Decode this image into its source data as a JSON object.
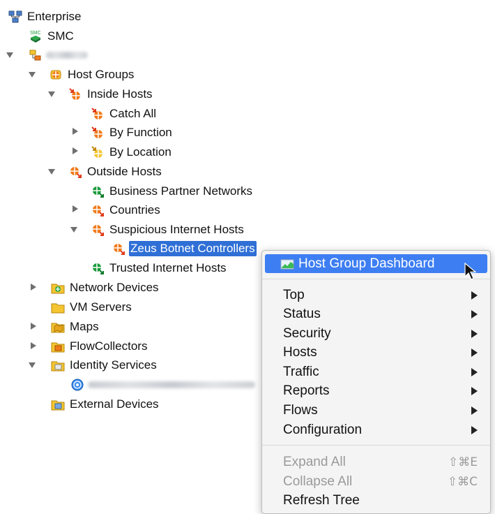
{
  "tree": {
    "enterprise": "Enterprise",
    "smc": "SMC",
    "host_groups": "Host Groups",
    "inside_hosts": "Inside Hosts",
    "catch_all": "Catch All",
    "by_function": "By Function",
    "by_location": "By Location",
    "outside_hosts": "Outside Hosts",
    "business_partner_networks": "Business Partner Networks",
    "countries": "Countries",
    "suspicious_internet_hosts": "Suspicious Internet Hosts",
    "zeus_botnet_controllers": "Zeus Botnet Controllers",
    "trusted_internet_hosts": "Trusted Internet Hosts",
    "network_devices": "Network Devices",
    "vm_servers": "VM Servers",
    "maps": "Maps",
    "flowcollectors": "FlowCollectors",
    "identity_services": "Identity Services",
    "external_devices": "External Devices"
  },
  "context_menu": {
    "host_group_dashboard": "Host Group Dashboard",
    "submenus": [
      "Top",
      "Status",
      "Security",
      "Hosts",
      "Traffic",
      "Reports",
      "Flows",
      "Configuration"
    ],
    "expand_all": "Expand All",
    "expand_all_shortcut": "⇧⌘E",
    "collapse_all": "Collapse All",
    "collapse_all_shortcut": "⇧⌘C",
    "refresh_tree": "Refresh Tree"
  },
  "colors": {
    "selection": "#2f6fd6",
    "menu_highlight": "#3d7ef2",
    "host_orange": "#f07a1a",
    "host_green": "#1a9a3a",
    "folder_yellow": "#f4c531"
  },
  "icons": [
    "network-icon",
    "smc-icon",
    "domain-icon",
    "host-group-icon",
    "folder-icon",
    "globe-icon",
    "dashboard-icon",
    "pointer-cursor-icon"
  ]
}
